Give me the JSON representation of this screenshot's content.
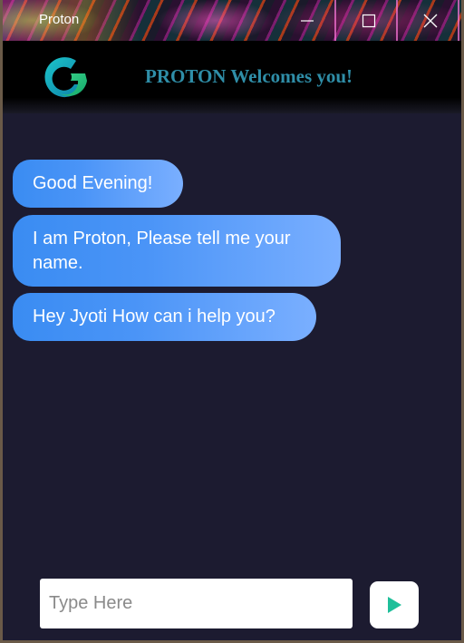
{
  "window": {
    "title": "Proton"
  },
  "header": {
    "title": "PROTON Welcomes you!",
    "logo_icon": "proton-g-logo-icon"
  },
  "chat": {
    "messages": [
      {
        "text": "Good Evening!"
      },
      {
        "text": "I am Proton, Please tell me your name."
      },
      {
        "text": "Hey Jyoti How can i help you?"
      }
    ]
  },
  "composer": {
    "placeholder": "Type Here",
    "value": "",
    "send_icon": "send-play-icon"
  },
  "colors": {
    "background": "#1c1b30",
    "header_background": "#000000",
    "header_title": "#2f8ea8",
    "bubble_start": "#3a8cf2",
    "bubble_end": "#7aafff",
    "send_icon": "#1fbf9a"
  }
}
